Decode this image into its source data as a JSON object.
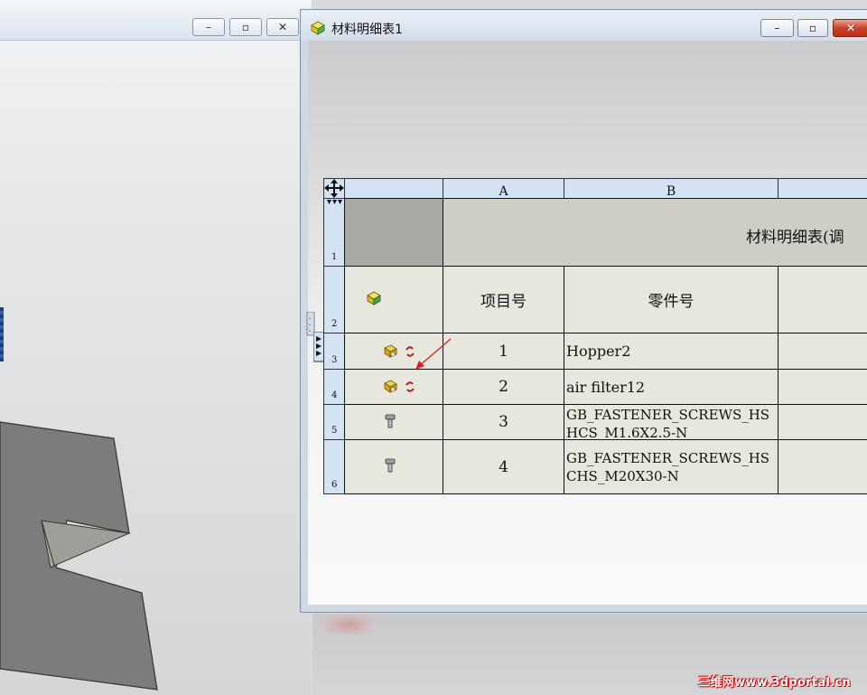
{
  "bg_window": {
    "buttons": [
      {
        "name": "minimize",
        "glyph": "–"
      },
      {
        "name": "restore",
        "glyph": "▫"
      },
      {
        "name": "close",
        "glyph": "✕"
      }
    ]
  },
  "bom_window": {
    "title": "材料明细表1",
    "buttons": [
      {
        "name": "minimize",
        "glyph": "–"
      },
      {
        "name": "restore",
        "glyph": "▫"
      },
      {
        "name": "close",
        "glyph": "✕"
      }
    ]
  },
  "table": {
    "column_headers": [
      "A",
      "B"
    ],
    "row_numbers": [
      "1",
      "2",
      "3",
      "4",
      "5",
      "6"
    ],
    "title_row": "材料明细表(调",
    "header_row": {
      "item_no": "项目号",
      "part_no": "零件号"
    },
    "rows": [
      {
        "icon": "assembly-link-icon",
        "item": "1",
        "part": "Hopper2"
      },
      {
        "icon": "assembly-link-icon",
        "item": "2",
        "part": "air filter12"
      },
      {
        "icon": "screw-icon",
        "item": "3",
        "part": "GB_FASTENER_SCREWS_HSHCS_M1.6X2.5-N"
      },
      {
        "icon": "screw-icon",
        "item": "4",
        "part": "GB_FASTENER_SCREWS_HSCHS_M20X30-N"
      }
    ]
  },
  "watermark": "三维网www.3dportal.cn",
  "colors": {
    "header_blue": "#d4e3f3",
    "cell_beige": "#e8e7dd",
    "title_gray": "#cfcec4",
    "arrow_red": "#e02020"
  }
}
